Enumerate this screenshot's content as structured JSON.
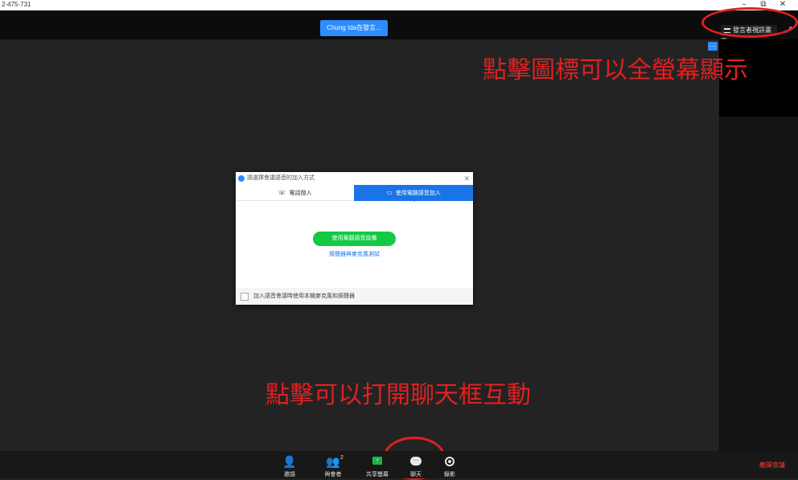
{
  "window": {
    "meeting_id": "2-475-731",
    "controls": {
      "minimize": "–",
      "restore": "⧉",
      "close": "✕"
    }
  },
  "topbar": {
    "presenter_badge": "Chung Ida在發言...",
    "view_button_label": "發言者視訊畫面",
    "fullscreen_icon": "⤢"
  },
  "annotations": {
    "fullscreen_hint": "點擊圖標可以全螢幕顯示",
    "chat_hint": "點擊可以打開聊天框互動"
  },
  "dialog": {
    "title": "請選擇會議語音的加入方式",
    "close": "✕",
    "tabs": [
      {
        "label": "電話撥入",
        "icon": "phone-icon",
        "glyph": "☏",
        "active": false
      },
      {
        "label": "使用電腦語音加入",
        "icon": "laptop-icon",
        "glyph": "▭",
        "active": true
      }
    ],
    "primary_button": "使用電腦語音設備",
    "test_link": "揚聲器與麥克風測試",
    "footer_checkbox_label": "加入語音會議時使用本機麥克風和揚聲器"
  },
  "toolbar": {
    "items": [
      {
        "label": "邀請",
        "icon": "invite-icon"
      },
      {
        "label": "與會者",
        "icon": "participants-icon",
        "count": "2"
      },
      {
        "label": "共享螢幕",
        "icon": "share-screen-icon"
      },
      {
        "label": "聊天",
        "icon": "chat-icon"
      },
      {
        "label": "錄影",
        "icon": "record-icon"
      }
    ],
    "leave_label": "離開會議"
  },
  "colors": {
    "accent_blue": "#2d8cff",
    "tab_blue": "#1a74e8",
    "join_green": "#14c944",
    "share_green": "#22b14c",
    "annotation_red": "#e02020",
    "leave_red": "#ff3b30"
  }
}
